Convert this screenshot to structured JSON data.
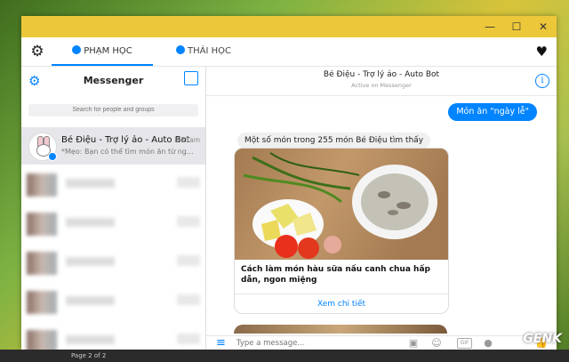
{
  "window": {
    "minimize": "—",
    "maximize": "☐",
    "close": "✕"
  },
  "tabs": [
    {
      "label": "PHẠM HỌC"
    },
    {
      "label": "THÁI HỌC"
    }
  ],
  "sidebar": {
    "title": "Messenger",
    "search_placeholder": "Search for people and groups",
    "conversation": {
      "name": "Bé Điệu - Trợ lý ảo - Auto Bot",
      "time": "8:31am",
      "preview": "*Mẹo: Bạn có thể tìm món ăn từ ng..."
    }
  },
  "chat": {
    "name": "Bé Điệu - Trợ lý ảo - Auto Bot",
    "status": "Active on Messenger",
    "outgoing": "Món ăn \"ngày lễ\"",
    "incoming": "Một số món trong 255 món Bé Điệu tìm thấy",
    "card": {
      "title": "Cách làm món hàu sữa nấu canh chua hấp dẫn, ngon miệng",
      "action": "Xem chi tiết"
    },
    "compose_placeholder": "Type a message...",
    "gif_label": "GIF"
  },
  "taskbar": {
    "status": "Page 2 of 2"
  },
  "watermark": "GENK",
  "icons": {
    "gear": "gear-icon",
    "heart": "heart-icon",
    "info": "info-icon",
    "compose": "compose-icon",
    "menu": "menu-icon"
  },
  "colors": {
    "accent": "#0084ff",
    "titlebar": "#ecc73a"
  }
}
